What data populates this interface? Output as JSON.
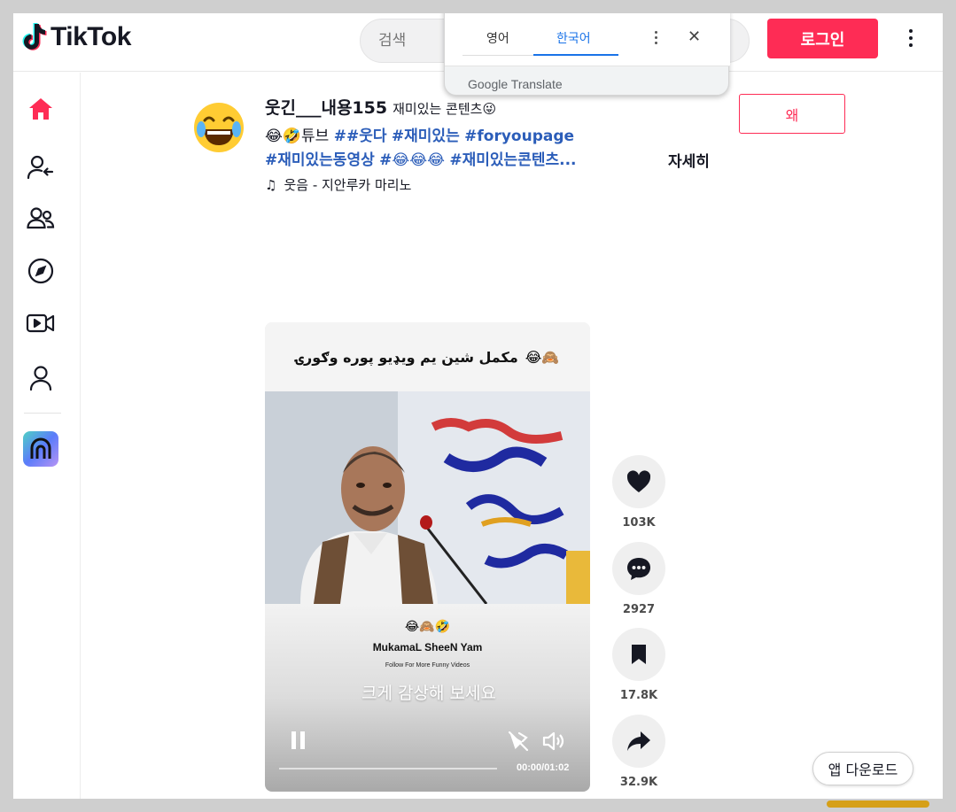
{
  "header": {
    "logo_text": "TikTok",
    "search_placeholder": "검색",
    "login_label": "로그인"
  },
  "translate_popup": {
    "tab_source": "영어",
    "tab_target": "한국어",
    "brand": "Google Translate"
  },
  "sidebar": {
    "items": [
      "home",
      "following",
      "friends",
      "explore",
      "live",
      "profile"
    ]
  },
  "post": {
    "author_name": "웃긴___내용155",
    "author_nickname": "재미있는 콘텐츠😜",
    "desc_prefix": "😂🤣튜브 ",
    "tags_line1": [
      "##웃다",
      "#재미있는",
      "#foryoupage"
    ],
    "tags_line2": [
      "#재미있는동영상",
      "#😂😂😂",
      "#재미있는콘텐츠..."
    ],
    "more_label": "자세히",
    "music": "웃음 - 지안루카 마리노",
    "follow_label": "왜"
  },
  "video": {
    "overlay_top_text": "مکمل شین یم ویډیو پوره وګورۍ",
    "overlay_top_emoji": "😂🙈",
    "bottom_emoji": "😂🙈🤣",
    "bottom_title": "MukamaL SheeN Yam",
    "bottom_subtitle": "Follow For More Funny Videos",
    "watch_full": "크게 감상해 보세요",
    "time": "00:00/01:02",
    "progress": 0
  },
  "actions": {
    "likes": "103K",
    "comments": "2927",
    "saves": "17.8K",
    "shares": "32.9K"
  },
  "footer": {
    "app_download": "앱 다운로드"
  },
  "colors": {
    "brand": "#fe2c55",
    "hashtag": "#2b5db9",
    "translate_accent": "#1a73e8"
  }
}
